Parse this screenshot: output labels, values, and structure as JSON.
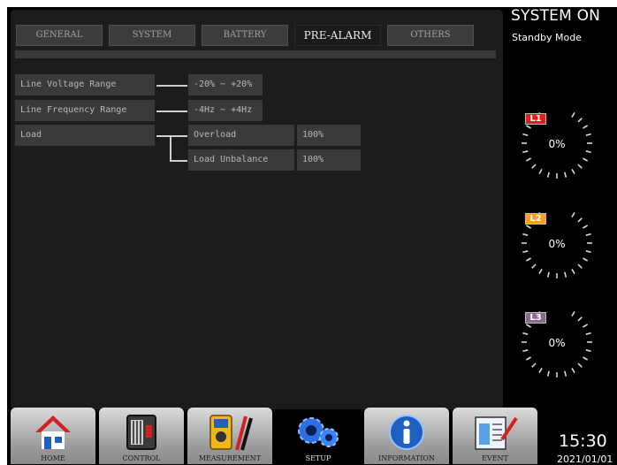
{
  "tabs": [
    {
      "label": "GENERAL",
      "active": false
    },
    {
      "label": "SYSTEM",
      "active": false
    },
    {
      "label": "BATTERY",
      "active": false
    },
    {
      "label": "PRE-ALARM",
      "active": true
    },
    {
      "label": "OTHERS",
      "active": false
    }
  ],
  "settings": {
    "line_voltage_range": {
      "label": "Line Voltage Range",
      "value": "-20% ~ +20%"
    },
    "line_frequency_range": {
      "label": "Line Frequency Range",
      "value": "-4Hz ~ +4Hz"
    },
    "load": {
      "label": "Load",
      "overload": {
        "label": "Overload",
        "value": "100%"
      },
      "load_unbalance": {
        "label": "Load Unbalance",
        "value": "100%"
      }
    }
  },
  "status": {
    "title": "SYSTEM ON",
    "mode": "Standby Mode"
  },
  "gauges": [
    {
      "label": "L1",
      "value": "0%",
      "color": "#e01e1e"
    },
    {
      "label": "L2",
      "value": "0%",
      "color": "#ff9a1a"
    },
    {
      "label": "L3",
      "value": "0%",
      "color": "#8a6a8a"
    }
  ],
  "nav": [
    {
      "label": "HOME",
      "icon": "house-icon",
      "active": false
    },
    {
      "label": "CONTROL",
      "icon": "control-panel-icon",
      "active": false
    },
    {
      "label": "MEASUREMENT",
      "icon": "multimeter-icon",
      "active": false
    },
    {
      "label": "SETUP",
      "icon": "gears-icon",
      "active": true
    },
    {
      "label": "INFORMATION",
      "icon": "info-icon",
      "active": false
    },
    {
      "label": "EVENT",
      "icon": "event-log-icon",
      "active": false
    }
  ],
  "clock": {
    "time": "15:30",
    "date": "2021/01/01"
  }
}
